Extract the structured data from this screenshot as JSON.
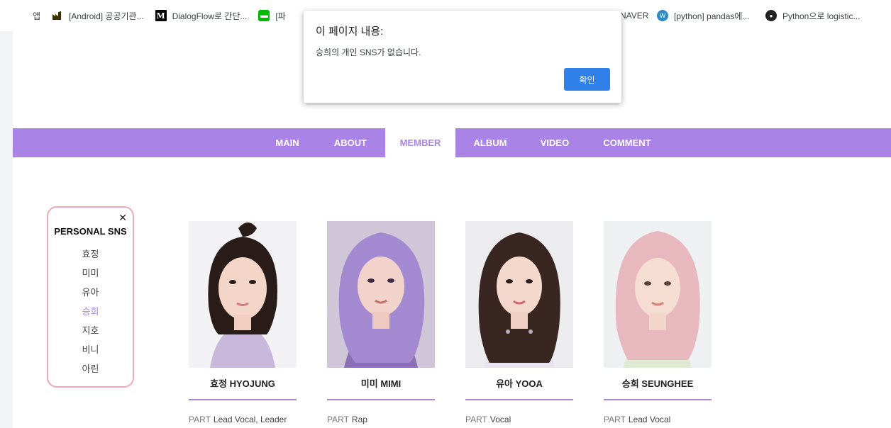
{
  "bookmarks": [
    {
      "icon": "apps-grid-icon",
      "label": "앱"
    },
    {
      "icon": "factory-icon",
      "label": "[Android] 공공기관..."
    },
    {
      "icon": "medium-m-icon",
      "label": "DialogFlow로 간단..."
    },
    {
      "icon": "line-icon",
      "label": "[파"
    }
  ],
  "bookmarks_right": [
    {
      "icon": "",
      "label": "NAVER"
    },
    {
      "icon": "wordpress-icon",
      "label": "[python] pandas에..."
    },
    {
      "icon": "python-icon",
      "label": "Python으로 logistic..."
    }
  ],
  "nav": {
    "items": [
      {
        "label": "MAIN",
        "active": false
      },
      {
        "label": "ABOUT",
        "active": false
      },
      {
        "label": "MEMBER",
        "active": true
      },
      {
        "label": "ALBUM",
        "active": false
      },
      {
        "label": "VIDEO",
        "active": false
      },
      {
        "label": "COMMENT",
        "active": false
      }
    ]
  },
  "sns_panel": {
    "close": "✕",
    "title": "PERSONAL SNS",
    "members": [
      "효정",
      "미미",
      "유아",
      "승희",
      "지호",
      "비니",
      "아린"
    ],
    "selected": "승희"
  },
  "members": [
    {
      "name": "효정  HYOJUNG",
      "part_label": "PART",
      "part": "Lead Vocal, Leader",
      "hair": "#2a1c18",
      "bg": "#f2f2f4",
      "top": "#c9b7dc"
    },
    {
      "name": "미미  MIMI",
      "part_label": "PART",
      "part": "Rap",
      "hair": "#a38ad0",
      "bg": "#cfc6d8",
      "top": "#8a6fb5"
    },
    {
      "name": "유아  YOOA",
      "part_label": "PART",
      "part": "Vocal",
      "hair": "#3a2620",
      "bg": "#ecebee",
      "top": "#e8e4ef"
    },
    {
      "name": "승희  SEUNGHEE",
      "part_label": "PART",
      "part": "Lead Vocal",
      "hair": "#e8b8bf",
      "bg": "#eef0f2",
      "top": "#dfe8d2"
    }
  ],
  "dialog": {
    "title": "이 페이지 내용:",
    "message": "승희의 개인 SNS가 없습니다.",
    "ok_label": "확인"
  },
  "colors": {
    "accent": "#a983e6",
    "sns_border": "#f0a8b4",
    "button": "#1a73e8"
  }
}
